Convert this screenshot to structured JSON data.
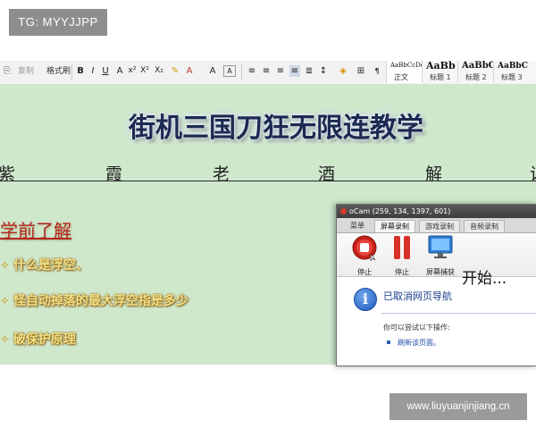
{
  "watermark_top": "TG: MYYJJPP",
  "watermark_bottom": "www.liuyuanjinjiang.cn",
  "toolbar": {
    "paste_label": "复制",
    "format_painter_label": "格式刷",
    "bold": "B",
    "italic": "I",
    "underline": "U",
    "styles": [
      {
        "preview": "AaBbCcDd",
        "label": "正文"
      },
      {
        "preview": "AaBb",
        "label": "标题 1"
      },
      {
        "preview": "AaBbC",
        "label": "标题 2"
      },
      {
        "preview": "AaBbC",
        "label": "标题 3"
      }
    ]
  },
  "document": {
    "title": "街机三国刀狂无限连教学",
    "subtitle_chars": [
      "紫",
      "霞",
      "老",
      "酒",
      "解",
      "说"
    ],
    "section_heading": "学前了解",
    "bullets": [
      "什么是浮空、",
      "怪自动掉落的最大浮空指是多少",
      "破保护原理"
    ]
  },
  "ocam": {
    "title": "oCam (259, 134, 1397, 601)",
    "tabs": [
      "菜单",
      "屏幕录制",
      "游戏录制",
      "音频录制"
    ],
    "tools": [
      {
        "label": "停止",
        "icon": "record-stop-icon"
      },
      {
        "label": "停止",
        "icon": "pause-icon"
      },
      {
        "label": "屏幕捕获",
        "icon": "monitor-icon"
      }
    ],
    "start_label": "开始...",
    "colors": {
      "record_red": "#c8201a",
      "titlebar": "#4a4a4a",
      "link_blue": "#1f4ca8"
    }
  },
  "error_page": {
    "info_icon": "i",
    "title": "已取消网页导航",
    "subtitle": "你可以尝试以下操作:",
    "link": "刷新该页面。"
  },
  "colors": {
    "doc_background": "#cfe8cc",
    "title_color": "#1b2a52",
    "heading_color": "#b3261e",
    "bullet_color": "#f0e08a"
  }
}
